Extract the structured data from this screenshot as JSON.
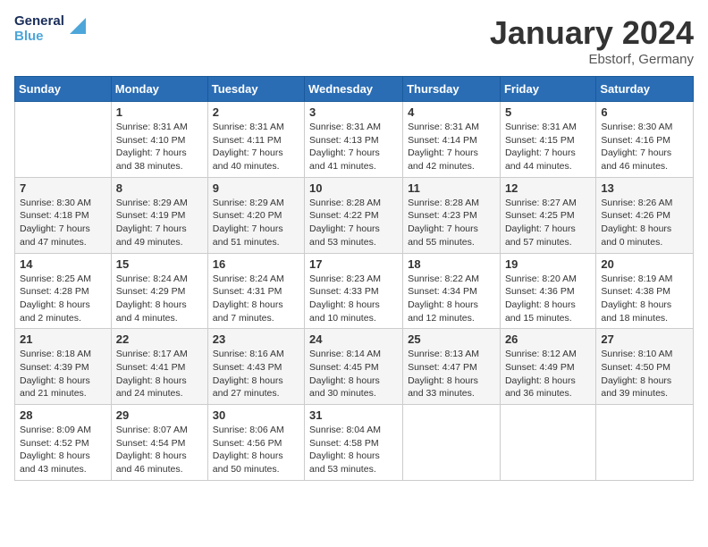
{
  "header": {
    "logo_line1": "General",
    "logo_line2": "Blue",
    "title": "January 2024",
    "subtitle": "Ebstorf, Germany"
  },
  "weekdays": [
    "Sunday",
    "Monday",
    "Tuesday",
    "Wednesday",
    "Thursday",
    "Friday",
    "Saturday"
  ],
  "weeks": [
    [
      {
        "day": "",
        "sunrise": "",
        "sunset": "",
        "daylight": ""
      },
      {
        "day": "1",
        "sunrise": "Sunrise: 8:31 AM",
        "sunset": "Sunset: 4:10 PM",
        "daylight": "Daylight: 7 hours and 38 minutes."
      },
      {
        "day": "2",
        "sunrise": "Sunrise: 8:31 AM",
        "sunset": "Sunset: 4:11 PM",
        "daylight": "Daylight: 7 hours and 40 minutes."
      },
      {
        "day": "3",
        "sunrise": "Sunrise: 8:31 AM",
        "sunset": "Sunset: 4:13 PM",
        "daylight": "Daylight: 7 hours and 41 minutes."
      },
      {
        "day": "4",
        "sunrise": "Sunrise: 8:31 AM",
        "sunset": "Sunset: 4:14 PM",
        "daylight": "Daylight: 7 hours and 42 minutes."
      },
      {
        "day": "5",
        "sunrise": "Sunrise: 8:31 AM",
        "sunset": "Sunset: 4:15 PM",
        "daylight": "Daylight: 7 hours and 44 minutes."
      },
      {
        "day": "6",
        "sunrise": "Sunrise: 8:30 AM",
        "sunset": "Sunset: 4:16 PM",
        "daylight": "Daylight: 7 hours and 46 minutes."
      }
    ],
    [
      {
        "day": "7",
        "sunrise": "Sunrise: 8:30 AM",
        "sunset": "Sunset: 4:18 PM",
        "daylight": "Daylight: 7 hours and 47 minutes."
      },
      {
        "day": "8",
        "sunrise": "Sunrise: 8:29 AM",
        "sunset": "Sunset: 4:19 PM",
        "daylight": "Daylight: 7 hours and 49 minutes."
      },
      {
        "day": "9",
        "sunrise": "Sunrise: 8:29 AM",
        "sunset": "Sunset: 4:20 PM",
        "daylight": "Daylight: 7 hours and 51 minutes."
      },
      {
        "day": "10",
        "sunrise": "Sunrise: 8:28 AM",
        "sunset": "Sunset: 4:22 PM",
        "daylight": "Daylight: 7 hours and 53 minutes."
      },
      {
        "day": "11",
        "sunrise": "Sunrise: 8:28 AM",
        "sunset": "Sunset: 4:23 PM",
        "daylight": "Daylight: 7 hours and 55 minutes."
      },
      {
        "day": "12",
        "sunrise": "Sunrise: 8:27 AM",
        "sunset": "Sunset: 4:25 PM",
        "daylight": "Daylight: 7 hours and 57 minutes."
      },
      {
        "day": "13",
        "sunrise": "Sunrise: 8:26 AM",
        "sunset": "Sunset: 4:26 PM",
        "daylight": "Daylight: 8 hours and 0 minutes."
      }
    ],
    [
      {
        "day": "14",
        "sunrise": "Sunrise: 8:25 AM",
        "sunset": "Sunset: 4:28 PM",
        "daylight": "Daylight: 8 hours and 2 minutes."
      },
      {
        "day": "15",
        "sunrise": "Sunrise: 8:24 AM",
        "sunset": "Sunset: 4:29 PM",
        "daylight": "Daylight: 8 hours and 4 minutes."
      },
      {
        "day": "16",
        "sunrise": "Sunrise: 8:24 AM",
        "sunset": "Sunset: 4:31 PM",
        "daylight": "Daylight: 8 hours and 7 minutes."
      },
      {
        "day": "17",
        "sunrise": "Sunrise: 8:23 AM",
        "sunset": "Sunset: 4:33 PM",
        "daylight": "Daylight: 8 hours and 10 minutes."
      },
      {
        "day": "18",
        "sunrise": "Sunrise: 8:22 AM",
        "sunset": "Sunset: 4:34 PM",
        "daylight": "Daylight: 8 hours and 12 minutes."
      },
      {
        "day": "19",
        "sunrise": "Sunrise: 8:20 AM",
        "sunset": "Sunset: 4:36 PM",
        "daylight": "Daylight: 8 hours and 15 minutes."
      },
      {
        "day": "20",
        "sunrise": "Sunrise: 8:19 AM",
        "sunset": "Sunset: 4:38 PM",
        "daylight": "Daylight: 8 hours and 18 minutes."
      }
    ],
    [
      {
        "day": "21",
        "sunrise": "Sunrise: 8:18 AM",
        "sunset": "Sunset: 4:39 PM",
        "daylight": "Daylight: 8 hours and 21 minutes."
      },
      {
        "day": "22",
        "sunrise": "Sunrise: 8:17 AM",
        "sunset": "Sunset: 4:41 PM",
        "daylight": "Daylight: 8 hours and 24 minutes."
      },
      {
        "day": "23",
        "sunrise": "Sunrise: 8:16 AM",
        "sunset": "Sunset: 4:43 PM",
        "daylight": "Daylight: 8 hours and 27 minutes."
      },
      {
        "day": "24",
        "sunrise": "Sunrise: 8:14 AM",
        "sunset": "Sunset: 4:45 PM",
        "daylight": "Daylight: 8 hours and 30 minutes."
      },
      {
        "day": "25",
        "sunrise": "Sunrise: 8:13 AM",
        "sunset": "Sunset: 4:47 PM",
        "daylight": "Daylight: 8 hours and 33 minutes."
      },
      {
        "day": "26",
        "sunrise": "Sunrise: 8:12 AM",
        "sunset": "Sunset: 4:49 PM",
        "daylight": "Daylight: 8 hours and 36 minutes."
      },
      {
        "day": "27",
        "sunrise": "Sunrise: 8:10 AM",
        "sunset": "Sunset: 4:50 PM",
        "daylight": "Daylight: 8 hours and 39 minutes."
      }
    ],
    [
      {
        "day": "28",
        "sunrise": "Sunrise: 8:09 AM",
        "sunset": "Sunset: 4:52 PM",
        "daylight": "Daylight: 8 hours and 43 minutes."
      },
      {
        "day": "29",
        "sunrise": "Sunrise: 8:07 AM",
        "sunset": "Sunset: 4:54 PM",
        "daylight": "Daylight: 8 hours and 46 minutes."
      },
      {
        "day": "30",
        "sunrise": "Sunrise: 8:06 AM",
        "sunset": "Sunset: 4:56 PM",
        "daylight": "Daylight: 8 hours and 50 minutes."
      },
      {
        "day": "31",
        "sunrise": "Sunrise: 8:04 AM",
        "sunset": "Sunset: 4:58 PM",
        "daylight": "Daylight: 8 hours and 53 minutes."
      },
      {
        "day": "",
        "sunrise": "",
        "sunset": "",
        "daylight": ""
      },
      {
        "day": "",
        "sunrise": "",
        "sunset": "",
        "daylight": ""
      },
      {
        "day": "",
        "sunrise": "",
        "sunset": "",
        "daylight": ""
      }
    ]
  ]
}
